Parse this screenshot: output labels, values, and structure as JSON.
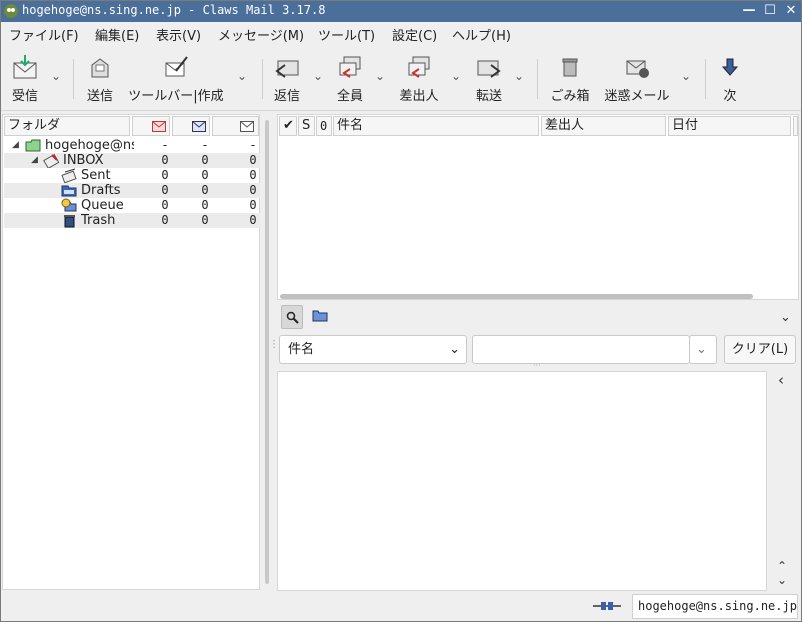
{
  "window": {
    "title": "hogehoge@ns.sing.ne.jp - Claws Mail 3.17.8",
    "minimize": "—",
    "maximize": "☐",
    "close": "✕"
  },
  "menu": [
    "ファイル(F)",
    "編集(E)",
    "表示(V)",
    "メッセージ(M)",
    "ツール(T)",
    "設定(C)",
    "ヘルプ(H)"
  ],
  "toolbar": {
    "receive": "受信",
    "send": "送信",
    "compose": "ツールバー|作成",
    "reply": "返信",
    "reply_all": "全員",
    "reply_sender": "差出人",
    "forward": "転送",
    "trash": "ごみ箱",
    "spam": "迷惑メール",
    "next": "次"
  },
  "folders": {
    "header": "フォルダ",
    "rows": [
      {
        "name": "hogehoge@ns.sing.ne.jp",
        "new": "-",
        "unread": "-",
        "total": "-"
      },
      {
        "name": "INBOX",
        "new": "0",
        "unread": "0",
        "total": "0"
      },
      {
        "name": "Sent",
        "new": "0",
        "unread": "0",
        "total": "0"
      },
      {
        "name": "Drafts",
        "new": "0",
        "unread": "0",
        "total": "0"
      },
      {
        "name": "Queue",
        "new": "0",
        "unread": "0",
        "total": "0"
      },
      {
        "name": "Trash",
        "new": "0",
        "unread": "0",
        "total": "0"
      }
    ]
  },
  "message_list": {
    "col_mark": "✔",
    "col_status": "S",
    "col_attach": "🖉",
    "col_subject": "件名",
    "col_from": "差出人",
    "col_date": "日付"
  },
  "quick_search": {
    "field": "件名",
    "value": "",
    "clear_button": "クリア(L)"
  },
  "status": {
    "account": "hogehoge@ns.sing.ne.jp"
  },
  "colors": {
    "titlebar": "#4a6f9b",
    "background": "#efefef"
  }
}
